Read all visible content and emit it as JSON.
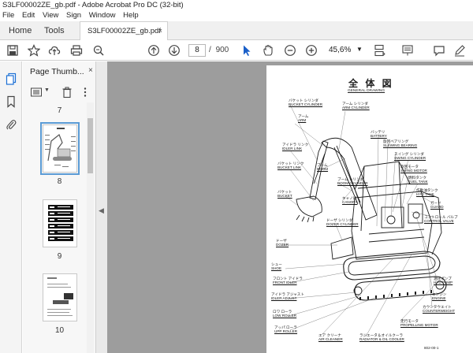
{
  "window": {
    "title": "S3LF00002ZE_gb.pdf - Adobe Acrobat Pro DC (32-bit)"
  },
  "menu": [
    "File",
    "Edit",
    "View",
    "Sign",
    "Window",
    "Help"
  ],
  "tabs": {
    "home": "Home",
    "tools": "Tools",
    "doc": "S3LF00002ZE_gb.pdf",
    "doc_close": "×"
  },
  "toolbar": {
    "page_current": "8",
    "page_sep": "/",
    "page_total": "900",
    "zoom": "45,6%"
  },
  "panel": {
    "title": "Page Thumb...",
    "close": "×",
    "thumbnails": [
      {
        "num": "7"
      },
      {
        "num": "8",
        "selected": true
      },
      {
        "num": "9"
      },
      {
        "num": "10"
      }
    ]
  },
  "document": {
    "title": "全 体 図",
    "subtitle": "GENERAL DRAWING",
    "labels": [
      {
        "jp": "バケット シリンダ",
        "en": "BUCKET CYLINDER"
      },
      {
        "jp": "アーム",
        "en": "ARM"
      },
      {
        "jp": "アーム シリンダ",
        "en": "ARM CYLINDER"
      },
      {
        "jp": "アイドラ リンク",
        "en": "IDLER LINK"
      },
      {
        "jp": "ブーム",
        "en": "BOOM"
      },
      {
        "jp": "バケット リンク",
        "en": "BUCKET LINK"
      },
      {
        "jp": "ブーム シリンダ",
        "en": "BOOM CYLINDER"
      },
      {
        "jp": "バケット",
        "en": "BUCKET"
      },
      {
        "jp": "キャノピ",
        "en": "CANOPY"
      },
      {
        "jp": "ドーザ シリンダ",
        "en": "DOZER CYLINDER"
      },
      {
        "jp": "ドーザ",
        "en": "DOZER"
      },
      {
        "jp": "シュー",
        "en": "SHOE"
      },
      {
        "jp": "フロント アイドラ",
        "en": "FRONT IDLER"
      },
      {
        "jp": "アイドラ アジャスト",
        "en": "IDLER ADJUST"
      },
      {
        "jp": "ロワ ローラ",
        "en": "LOW ROLLER"
      },
      {
        "jp": "アッパ ローラ",
        "en": "UPP ROLLER"
      },
      {
        "jp": "エア クリーナ",
        "en": "AIR CLEANER"
      },
      {
        "jp": "ラジエータ＆オイルクーラ",
        "en": "RADIATOR & OIL COOLER"
      },
      {
        "jp": "走行モータ",
        "en": "PROPELLING MOTOR"
      },
      {
        "jp": "カウンタウエイト",
        "en": "COUNTERWEIGHT"
      },
      {
        "jp": "エンジン",
        "en": "ENGINE"
      },
      {
        "jp": "油圧ポンプ",
        "en": "HYD PUMP"
      },
      {
        "jp": "コントロール バルブ",
        "en": "CONTROL VALVE"
      },
      {
        "jp": "ガード",
        "en": "GUARD"
      },
      {
        "jp": "作動油タンク",
        "en": "HYD TANK"
      },
      {
        "jp": "燃料タンク",
        "en": "FUEL TANK"
      },
      {
        "jp": "旋回モータ",
        "en": "SWING MOTOR"
      },
      {
        "jp": "スイング シリンダ",
        "en": "SWING CYLINDER"
      },
      {
        "jp": "旋回ベアリング",
        "en": "SLEWING BEARING"
      },
      {
        "jp": "バッテリ",
        "en": "BATTERY"
      }
    ],
    "footer": "802-00-1"
  }
}
